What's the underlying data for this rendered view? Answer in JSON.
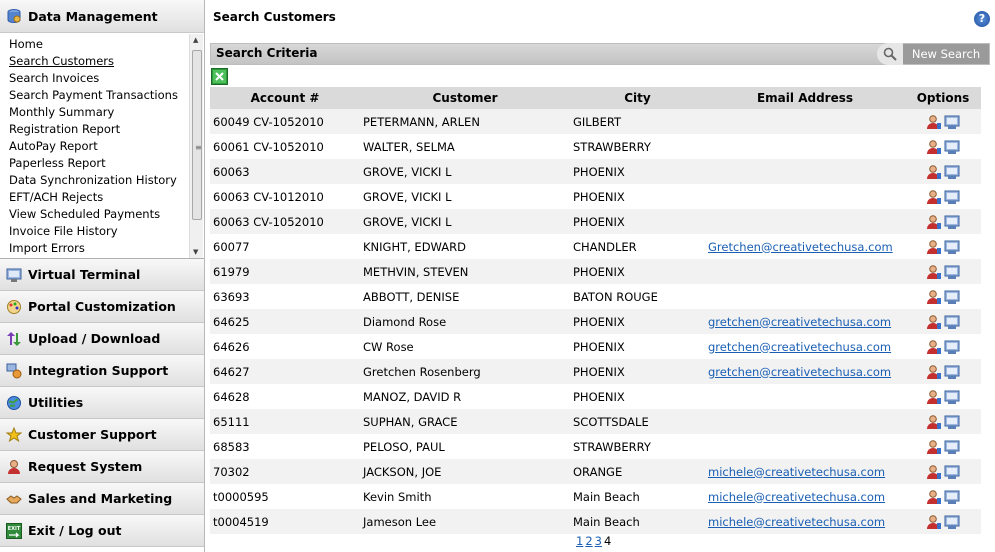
{
  "sidebar": {
    "data_management": {
      "title": "Data Management",
      "items": [
        "Home",
        "Search Customers",
        "Search Invoices",
        "Search Payment Transactions",
        "Monthly Summary",
        "Registration Report",
        "AutoPay Report",
        "Paperless Report",
        "Data Synchronization History",
        "EFT/ACH Rejects",
        "View Scheduled Payments",
        "Invoice File History",
        "Import Errors"
      ]
    },
    "sections": [
      {
        "label": "Virtual Terminal",
        "icon": "terminal-icon"
      },
      {
        "label": "Portal Customization",
        "icon": "palette-icon"
      },
      {
        "label": "Upload / Download",
        "icon": "upload-download-icon"
      },
      {
        "label": "Integration Support",
        "icon": "integration-icon"
      },
      {
        "label": "Utilities",
        "icon": "utilities-globe-icon"
      },
      {
        "label": "Customer Support",
        "icon": "star-support-icon"
      },
      {
        "label": "Request System",
        "icon": "person-request-icon"
      },
      {
        "label": "Sales and Marketing",
        "icon": "handshake-icon"
      },
      {
        "label": "Exit / Log out",
        "icon": "exit-icon"
      }
    ]
  },
  "main": {
    "title": "Search Customers",
    "criteria_label": "Search Criteria",
    "new_search_label": "New Search",
    "columns": [
      "Account #",
      "Customer",
      "City",
      "Email Address",
      "Options"
    ],
    "rows": [
      {
        "account": "60049 CV-1052010",
        "customer": "PETERMANN, ARLEN",
        "city": "GILBERT",
        "email": ""
      },
      {
        "account": "60061 CV-1052010",
        "customer": "WALTER, SELMA",
        "city": "STRAWBERRY",
        "email": ""
      },
      {
        "account": "60063",
        "customer": "GROVE, VICKI L",
        "city": "PHOENIX",
        "email": ""
      },
      {
        "account": "60063 CV-1012010",
        "customer": "GROVE, VICKI L",
        "city": "PHOENIX",
        "email": ""
      },
      {
        "account": "60063 CV-1052010",
        "customer": "GROVE, VICKI L",
        "city": "PHOENIX",
        "email": ""
      },
      {
        "account": "60077",
        "customer": "KNIGHT, EDWARD",
        "city": "CHANDLER",
        "email": "Gretchen@creativetechusa.com"
      },
      {
        "account": "61979",
        "customer": "METHVIN, STEVEN",
        "city": "PHOENIX",
        "email": ""
      },
      {
        "account": "63693",
        "customer": "ABBOTT, DENISE",
        "city": "BATON ROUGE",
        "email": ""
      },
      {
        "account": "64625",
        "customer": "Diamond Rose",
        "city": "PHOENIX",
        "email": "gretchen@creativetechusa.com"
      },
      {
        "account": "64626",
        "customer": "CW Rose",
        "city": "PHOENIX",
        "email": "gretchen@creativetechusa.com"
      },
      {
        "account": "64627",
        "customer": "Gretchen Rosenberg",
        "city": "PHOENIX",
        "email": "gretchen@creativetechusa.com"
      },
      {
        "account": "64628",
        "customer": "MANOZ, DAVID R",
        "city": "PHOENIX",
        "email": ""
      },
      {
        "account": "65111",
        "customer": "SUPHAN, GRACE",
        "city": "SCOTTSDALE",
        "email": ""
      },
      {
        "account": "68583",
        "customer": "PELOSO, PAUL",
        "city": "STRAWBERRY",
        "email": ""
      },
      {
        "account": "70302",
        "customer": "JACKSON, JOE",
        "city": "ORANGE",
        "email": "michele@creativetechusa.com"
      },
      {
        "account": "t0000595",
        "customer": "Kevin Smith",
        "city": "Main Beach",
        "email": "michele@creativetechusa.com"
      },
      {
        "account": "t0004519",
        "customer": "Jameson Lee",
        "city": "Main Beach",
        "email": "michele@creativetechusa.com"
      }
    ],
    "pager": {
      "links": [
        "1",
        "2",
        "3"
      ],
      "current": "4"
    }
  }
}
